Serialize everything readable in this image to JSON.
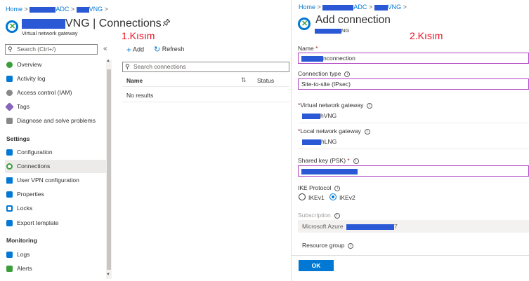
{
  "left": {
    "breadcrumb": {
      "home": "Home",
      "separator": ">",
      "item1_suffix": "ADC",
      "item2_suffix": "VNG"
    },
    "title_suffix": "VNG | Connections",
    "subtitle": "Virtual network gateway",
    "search_placeholder": "Search (Ctrl+/)",
    "collapse": "«",
    "nav": [
      {
        "label": "Overview",
        "icon": "overview-icon",
        "color": "#3a9e3a"
      },
      {
        "label": "Activity log",
        "icon": "activity-log-icon",
        "color": "#0078d4"
      },
      {
        "label": "Access control (IAM)",
        "icon": "iam-icon",
        "color": "#605e5c"
      },
      {
        "label": "Tags",
        "icon": "tag-icon",
        "color": "#8764b8"
      },
      {
        "label": "Diagnose and solve problems",
        "icon": "wrench-icon",
        "color": "#605e5c"
      }
    ],
    "settings_title": "Settings",
    "settings": [
      {
        "label": "Configuration",
        "icon": "configuration-icon",
        "color": "#0078d4"
      },
      {
        "label": "Connections",
        "icon": "connections-icon",
        "color": "#3a9e3a"
      },
      {
        "label": "User VPN configuration",
        "icon": "vpn-icon",
        "color": "#0078d4"
      },
      {
        "label": "Properties",
        "icon": "properties-icon",
        "color": "#0078d4"
      },
      {
        "label": "Locks",
        "icon": "lock-icon",
        "color": "#0078d4"
      },
      {
        "label": "Export template",
        "icon": "export-icon",
        "color": "#0078d4"
      }
    ],
    "monitoring_title": "Monitoring",
    "monitoring": [
      {
        "label": "Logs",
        "icon": "logs-icon",
        "color": "#0078d4"
      },
      {
        "label": "Alerts",
        "icon": "alerts-icon",
        "color": "#3a9e3a"
      }
    ]
  },
  "middle": {
    "annotation": "1.Kısım",
    "add_label": "Add",
    "refresh_label": "Refresh",
    "search_placeholder": "Search connections",
    "col_name": "Name",
    "col_status": "Status",
    "no_results": "No results"
  },
  "right": {
    "breadcrumb": {
      "home": "Home",
      "separator": ">",
      "item1_suffix": "ADC",
      "item2_suffix": "VNG"
    },
    "title": "Add connection",
    "subtitle_suffix": "NG",
    "annotation": "2.Kısım",
    "name_label": "Name",
    "name_value_suffix": "nconnection",
    "conn_type_label": "Connection type",
    "conn_type_value": "Site-to-site (IPsec)",
    "vng_label": "Virtual network gateway",
    "vng_value_suffix": "hVNG",
    "lng_label": "Local network gateway",
    "lng_value_suffix": "hLNG",
    "psk_label": "Shared key (PSK)",
    "ike_label": "IKE Protocol",
    "ike_v1": "IKEv1",
    "ike_v2": "IKEv2",
    "subscription_label": "Subscription",
    "subscription_value": "Microsoft Azure",
    "subscription_tail": "7",
    "resource_group_label": "Resource group",
    "ok_label": "OK"
  }
}
